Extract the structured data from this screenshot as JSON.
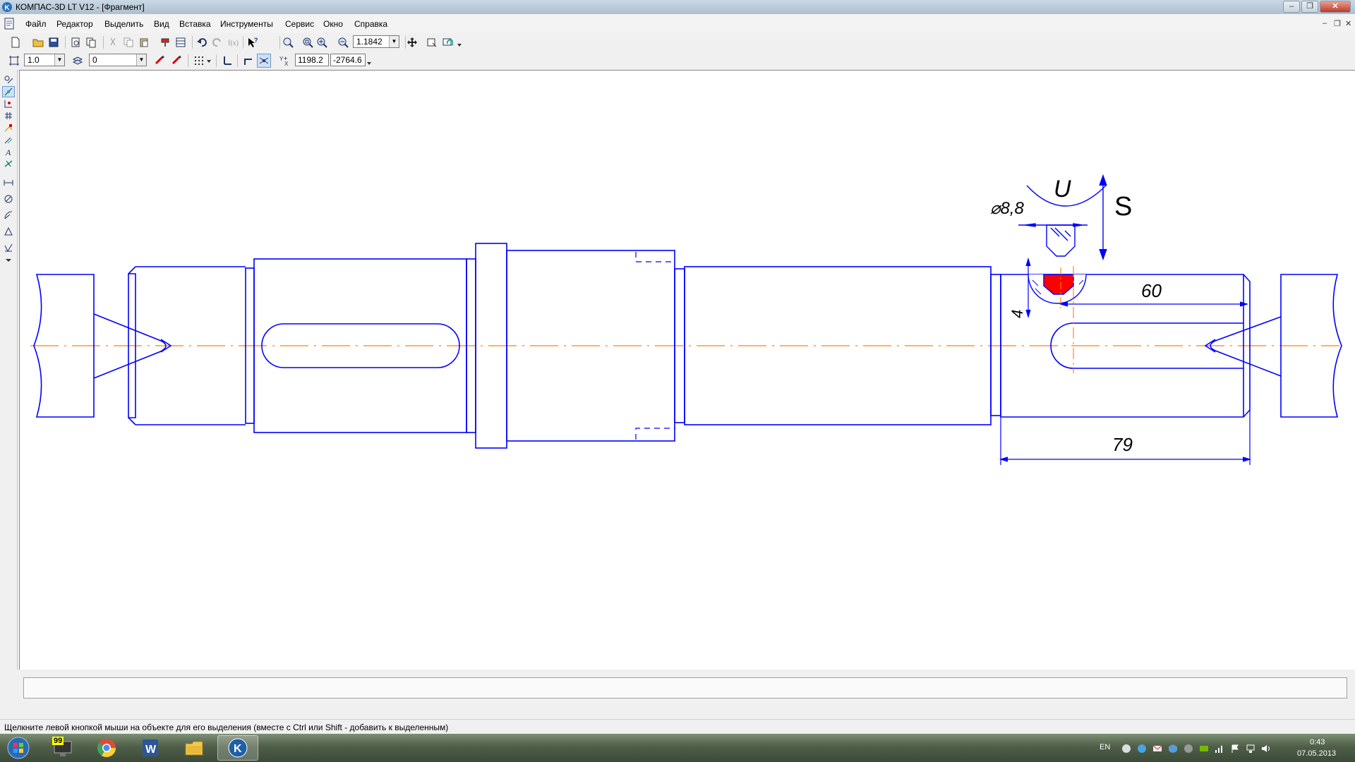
{
  "window": {
    "title": "КОМПАС-3D LT V12 - [Фрагмент]"
  },
  "menu": {
    "items": [
      "Файл",
      "Редактор",
      "Выделить",
      "Вид",
      "Вставка",
      "Инструменты",
      "Сервис",
      "Окно",
      "Справка"
    ]
  },
  "toolbar": {
    "zoom_value": "1.1842"
  },
  "toolbar2": {
    "step_value": "1.0",
    "layer_value": "0",
    "coord_x": "1198.2",
    "coord_y": "-2764.6"
  },
  "drawing": {
    "dim_diameter": "⌀8,8",
    "roughness_symbol": "U",
    "label_s": "S",
    "dim_depth": "4",
    "dim_60": "60",
    "dim_79": "79",
    "colors": {
      "contour": "#0000ff",
      "axis": "#ff8000",
      "highlight": "#ff0000"
    }
  },
  "status": {
    "hint": "Щелкните левой кнопкой мыши на объекте для его выделения (вместе с Ctrl или Shift - добавить к выделенным)"
  },
  "taskbar": {
    "notification_count": "99",
    "language": "EN",
    "time": "0:43",
    "date": "07.05.2013"
  }
}
